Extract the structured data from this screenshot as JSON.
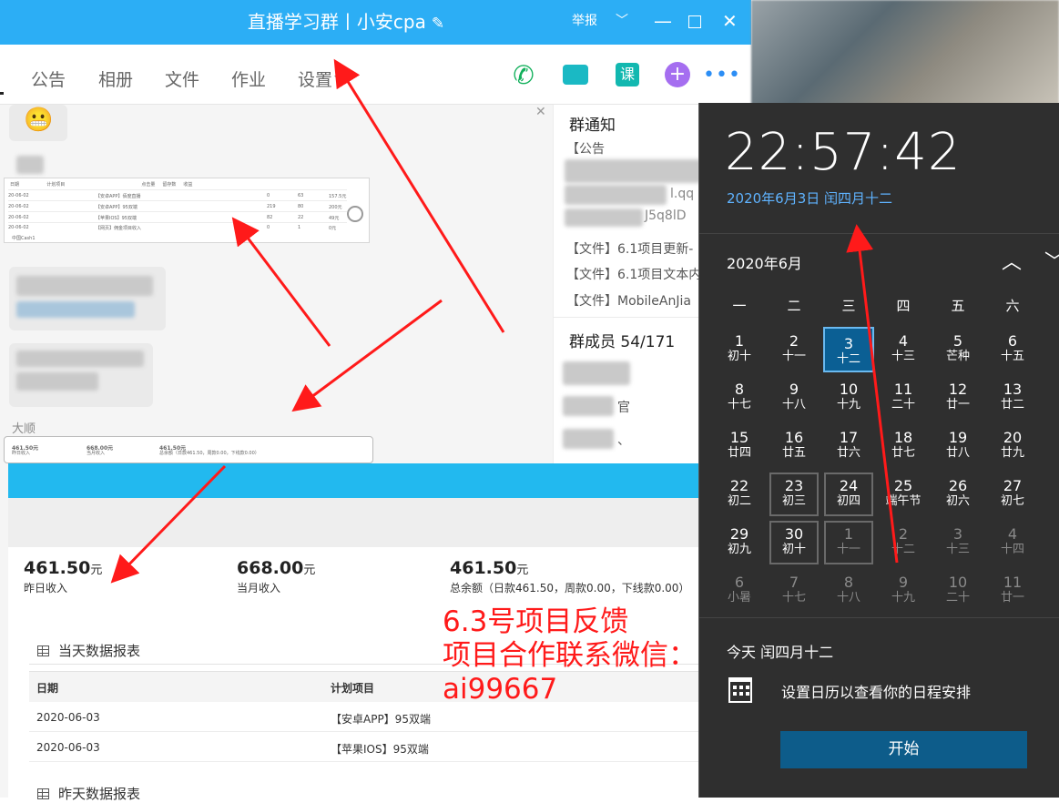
{
  "chat_window": {
    "title": "直播学习群丨小安cpa",
    "edit_glyph": "✎",
    "report_label": "举报",
    "chevron_glyph": "﹀",
    "minimize_glyph": "—",
    "close_glyph": "✕",
    "tabs": [
      {
        "label": "公告"
      },
      {
        "label": "相册"
      },
      {
        "label": "文件"
      },
      {
        "label": "作业"
      },
      {
        "label": "设置"
      }
    ],
    "settings_chevron": "﹀",
    "tool_icons": {
      "call": "phone-icon",
      "video": "video-icon",
      "course": "course-icon",
      "course_label": "课",
      "plus": "plus-icon",
      "plus_label": "+",
      "more": "more-icon",
      "more_label": "•••"
    },
    "chat": {
      "emoji": "😬",
      "sender_name": "大顺"
    },
    "right_panel": {
      "notice_heading": "群通知",
      "notice_prefix": "【公告",
      "notice_fragment_1": "l.qq",
      "notice_fragment_2": "J5q8lD",
      "files": [
        "【文件】6.1项目更新-",
        "【文件】6.1项目文本内",
        "【文件】MobileAnJia"
      ],
      "members_heading": "群成员 54/171",
      "member_fragment_1": "官",
      "member_fragment_2": "、"
    }
  },
  "report": {
    "stats": [
      {
        "value": "461.50",
        "unit": "元",
        "label": "昨日收入"
      },
      {
        "value": "668.00",
        "unit": "元",
        "label": "当月收入"
      },
      {
        "value": "461.50",
        "unit": "元",
        "label": "总余额（日款461.50，周款0.00，下线款0.00）"
      }
    ],
    "today_section": "当天数据报表",
    "yesterday_section": "昨天数据报表",
    "columns": [
      "日期",
      "计划项目"
    ],
    "rows": [
      {
        "date": "2020-06-03",
        "project": "【安卓APP】95双端"
      },
      {
        "date": "2020-06-03",
        "project": "【苹果IOS】95双端"
      }
    ]
  },
  "thumbnail_report": {
    "rows": [
      {
        "date": "20-06-02",
        "project": "【安卓APP】佰度直播",
        "v1": "0",
        "v2": "63",
        "v3": "157.5元"
      },
      {
        "date": "20-06-02",
        "project": "【安卓APP】95双端",
        "v1": "219",
        "v2": "80",
        "v3": "200元"
      },
      {
        "date": "20-06-02",
        "project": "【苹果IOS】95双端",
        "v1": "82",
        "v2": "22",
        "v3": "49元"
      },
      {
        "date": "20-06-02",
        "project": "【网页】佣金项目收入",
        "v1": "0",
        "v2": "1",
        "v3": "0元"
      }
    ],
    "footer": "中国Cash1",
    "stats": [
      {
        "value": "461.50元",
        "label": "昨日收入"
      },
      {
        "value": "668.00元",
        "label": "当月收入"
      },
      {
        "value": "461.50元",
        "label": "总余额（日款461.50，周款0.00，下线款0.00）"
      }
    ]
  },
  "annotation": {
    "line1": "6.3号项目反馈",
    "line2": "项目合作联系微信：",
    "line3": "ai99667",
    "color": "#ff1a1a"
  },
  "clock_flyout": {
    "time": "22:57:42",
    "date": "2020年6月3日 闰四月十二",
    "month_label": "2020年6月",
    "up_glyph": "︿",
    "down_glyph": "﹀",
    "weekdays": [
      "一",
      "二",
      "三",
      "四",
      "五",
      "六"
    ],
    "weeks": [
      [
        {
          "d": "1",
          "l": "初十"
        },
        {
          "d": "2",
          "l": "十一"
        },
        {
          "d": "3",
          "l": "十二",
          "today": true
        },
        {
          "d": "4",
          "l": "十三"
        },
        {
          "d": "5",
          "l": "芒种"
        },
        {
          "d": "6",
          "l": "十五"
        }
      ],
      [
        {
          "d": "8",
          "l": "十七"
        },
        {
          "d": "9",
          "l": "十八"
        },
        {
          "d": "10",
          "l": "十九"
        },
        {
          "d": "11",
          "l": "二十"
        },
        {
          "d": "12",
          "l": "廿一"
        },
        {
          "d": "13",
          "l": "廿二"
        }
      ],
      [
        {
          "d": "15",
          "l": "廿四"
        },
        {
          "d": "16",
          "l": "廿五"
        },
        {
          "d": "17",
          "l": "廿六"
        },
        {
          "d": "18",
          "l": "廿七"
        },
        {
          "d": "19",
          "l": "廿八"
        },
        {
          "d": "20",
          "l": "廿九"
        }
      ],
      [
        {
          "d": "22",
          "l": "初二"
        },
        {
          "d": "23",
          "l": "初三",
          "boxed": true
        },
        {
          "d": "24",
          "l": "初四",
          "boxed": true
        },
        {
          "d": "25",
          "l": "端午节"
        },
        {
          "d": "26",
          "l": "初六"
        },
        {
          "d": "27",
          "l": "初七"
        }
      ],
      [
        {
          "d": "29",
          "l": "初九"
        },
        {
          "d": "30",
          "l": "初十",
          "boxed": true
        },
        {
          "d": "1",
          "l": "十一",
          "other": true,
          "boxed": true
        },
        {
          "d": "2",
          "l": "十二",
          "other": true
        },
        {
          "d": "3",
          "l": "十三",
          "other": true
        },
        {
          "d": "4",
          "l": "十四",
          "other": true
        }
      ],
      [
        {
          "d": "6",
          "l": "小暑",
          "other": true
        },
        {
          "d": "7",
          "l": "十七",
          "other": true
        },
        {
          "d": "8",
          "l": "十八",
          "other": true
        },
        {
          "d": "9",
          "l": "十九",
          "other": true
        },
        {
          "d": "10",
          "l": "二十",
          "other": true
        },
        {
          "d": "11",
          "l": "廿一",
          "other": true
        }
      ]
    ],
    "agenda_day": "今天 闰四月十二",
    "agenda_text": "设置日历以查看你的日程安排",
    "start_button": "开始"
  }
}
